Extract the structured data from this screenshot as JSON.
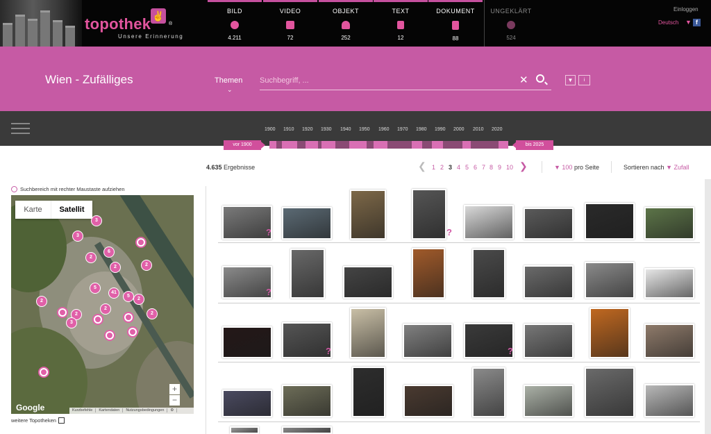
{
  "brand": {
    "name": "topothek",
    "tagline": "Unsere Erinnerung",
    "reg": "®"
  },
  "categories": [
    {
      "label": "BILD",
      "count": "4.211",
      "icon": "image-icon"
    },
    {
      "label": "VIDEO",
      "count": "72",
      "icon": "video-icon"
    },
    {
      "label": "OBJEKT",
      "count": "252",
      "icon": "object-icon"
    },
    {
      "label": "TEXT",
      "count": "12",
      "icon": "text-icon"
    },
    {
      "label": "DOKUMENT",
      "count": "88",
      "icon": "document-icon"
    },
    {
      "label": "UNGEKLÄRT",
      "count": "524",
      "icon": "question-icon"
    }
  ],
  "header": {
    "login": "Einloggen",
    "language": "Deutsch",
    "facebook": "f"
  },
  "search": {
    "title": "Wien - Zufälliges",
    "themes_label": "Themen",
    "placeholder": "Suchbegriff, ..."
  },
  "timeline": {
    "years": [
      "1900",
      "1910",
      "1920",
      "1930",
      "1940",
      "1950",
      "1960",
      "1970",
      "1980",
      "1990",
      "2000",
      "2010",
      "2020"
    ],
    "from_label": "vor 1900",
    "to_label": "bis 2025"
  },
  "results": {
    "count": "4.635",
    "label": "Ergebnisse"
  },
  "pagination": {
    "pages": [
      "1",
      "2",
      "3",
      "4",
      "5",
      "6",
      "7",
      "8",
      "9",
      "10"
    ],
    "current": "3"
  },
  "per_page": {
    "value": "100",
    "label": "pro Seite"
  },
  "sort": {
    "label": "Sortieren nach",
    "value": "Zufall"
  },
  "map": {
    "hint": "Suchbereich mit rechter Maustaste aufziehen",
    "type_map": "Karte",
    "type_satellite": "Satellit",
    "zoom_in": "+",
    "zoom_out": "−",
    "google": "Google",
    "footer": [
      "Kurzbefehle",
      "Kartendaten",
      "Nutzungsbedingungen"
    ],
    "markers": [
      "3",
      "3",
      "6",
      "2",
      "2",
      "2",
      "5",
      "41",
      "5",
      "2",
      "2",
      "2",
      "2",
      "3",
      "2"
    ],
    "more_topotheken": "weitere Topotheken"
  }
}
